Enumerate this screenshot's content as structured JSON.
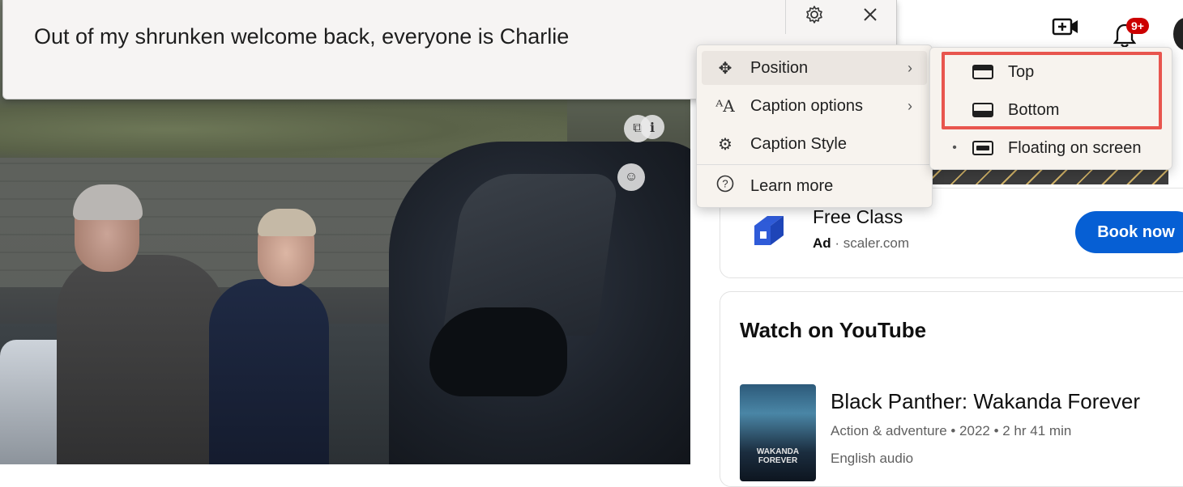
{
  "caption": {
    "text": "Out of my shrunken welcome back, everyone is Charlie",
    "settings_icon": "gear-icon",
    "close_icon": "close-icon"
  },
  "header": {
    "create_icon": "video-plus-icon",
    "notifications_icon": "bell-icon",
    "notifications_badge": "9+"
  },
  "context_menu": {
    "items": [
      {
        "label": "Position",
        "icon": "move-icon",
        "has_submenu": true
      },
      {
        "label": "Caption options",
        "icon": "text-size-icon",
        "has_submenu": true
      },
      {
        "label": "Caption Style",
        "icon": "gear-icon",
        "has_submenu": false
      },
      {
        "label": "Learn more",
        "icon": "help-icon",
        "has_submenu": false
      }
    ]
  },
  "position_submenu": {
    "items": [
      {
        "label": "Top",
        "icon": "window-top-icon",
        "selected": false
      },
      {
        "label": "Bottom",
        "icon": "window-bottom-icon",
        "selected": false
      },
      {
        "label": "Floating on screen",
        "icon": "window-floating-icon",
        "selected": true
      }
    ],
    "highlight_color": "#e8554e"
  },
  "ad": {
    "title": "Free Class",
    "ad_label": "Ad",
    "domain": "scaler.com",
    "cta": "Book now",
    "cta_color": "#065fd4"
  },
  "watch": {
    "heading": "Watch on YouTube",
    "movie": {
      "title": "Black Panther: Wakanda Forever",
      "meta": "Action & adventure • 2022 • 2 hr 41 min",
      "audio": "English audio",
      "poster_text": "WAKANDA FOREVER"
    }
  }
}
